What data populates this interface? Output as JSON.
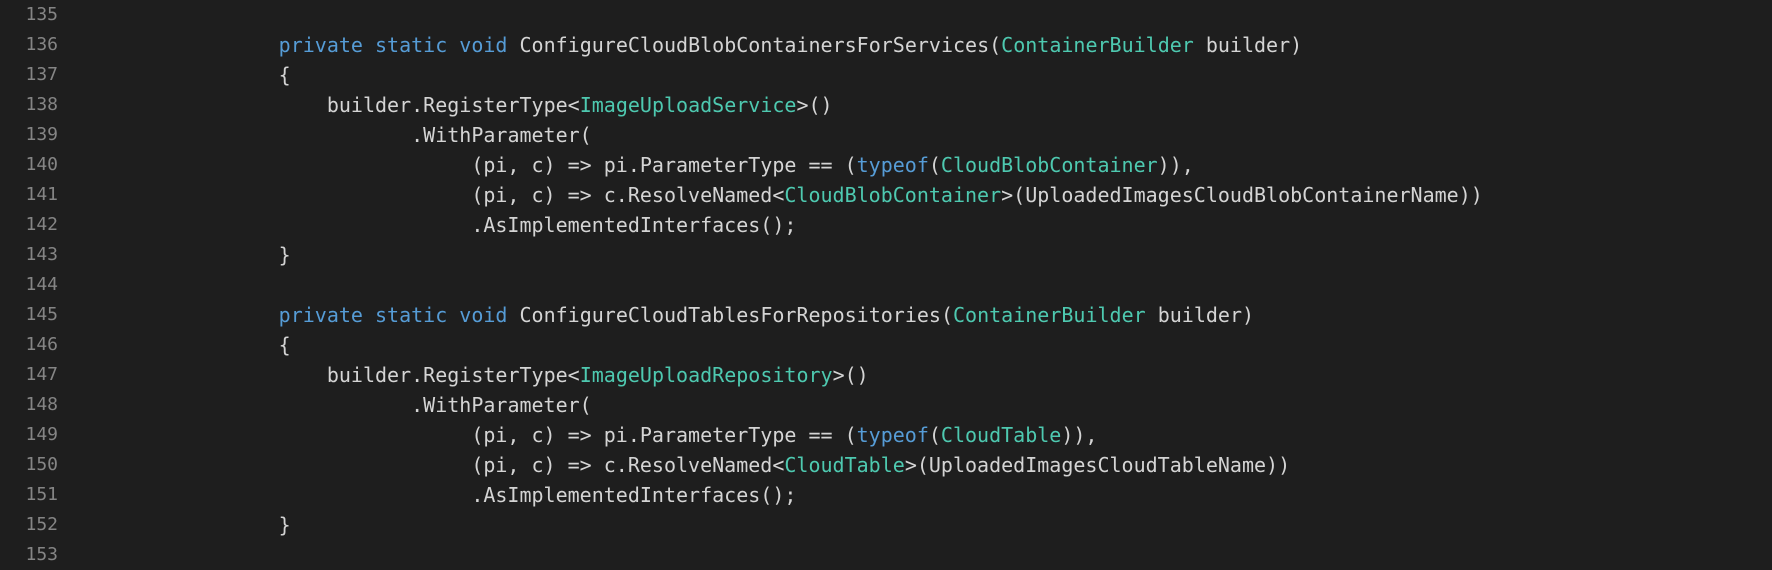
{
  "colors": {
    "background": "#1e1e1e",
    "gutter": "#858585",
    "text": "#d4d4d4",
    "keyword": "#569cd6",
    "type": "#4ec9b0"
  },
  "gutter": {
    "start": 135,
    "end": 153
  },
  "code": {
    "lines": [
      {
        "num": 135,
        "indent": 0,
        "tokens": []
      },
      {
        "num": 136,
        "indent": 16,
        "tokens": [
          {
            "t": "private",
            "c": "kw"
          },
          {
            "t": " "
          },
          {
            "t": "static",
            "c": "kw"
          },
          {
            "t": " "
          },
          {
            "t": "void",
            "c": "kw"
          },
          {
            "t": " ConfigureCloudBlobContainersForServices("
          },
          {
            "t": "ContainerBuilder",
            "c": "type"
          },
          {
            "t": " builder)"
          }
        ]
      },
      {
        "num": 137,
        "indent": 16,
        "tokens": [
          {
            "t": "{"
          }
        ]
      },
      {
        "num": 138,
        "indent": 20,
        "tokens": [
          {
            "t": "builder.RegisterType<"
          },
          {
            "t": "ImageUploadService",
            "c": "type"
          },
          {
            "t": ">()"
          }
        ]
      },
      {
        "num": 139,
        "indent": 27,
        "tokens": [
          {
            "t": ".WithParameter("
          }
        ]
      },
      {
        "num": 140,
        "indent": 32,
        "tokens": [
          {
            "t": "(pi, c) => pi.ParameterType == ("
          },
          {
            "t": "typeof",
            "c": "kw"
          },
          {
            "t": "("
          },
          {
            "t": "CloudBlobContainer",
            "c": "type"
          },
          {
            "t": ")),"
          }
        ]
      },
      {
        "num": 141,
        "indent": 32,
        "tokens": [
          {
            "t": "(pi, c) => c.ResolveNamed<"
          },
          {
            "t": "CloudBlobContainer",
            "c": "type"
          },
          {
            "t": ">(UploadedImagesCloudBlobContainerName))"
          }
        ]
      },
      {
        "num": 142,
        "indent": 32,
        "tokens": [
          {
            "t": ".AsImplementedInterfaces();"
          }
        ]
      },
      {
        "num": 143,
        "indent": 16,
        "tokens": [
          {
            "t": "}"
          }
        ]
      },
      {
        "num": 144,
        "indent": 0,
        "tokens": []
      },
      {
        "num": 145,
        "indent": 16,
        "tokens": [
          {
            "t": "private",
            "c": "kw"
          },
          {
            "t": " "
          },
          {
            "t": "static",
            "c": "kw"
          },
          {
            "t": " "
          },
          {
            "t": "void",
            "c": "kw"
          },
          {
            "t": " ConfigureCloudTablesForRepositories("
          },
          {
            "t": "ContainerBuilder",
            "c": "type"
          },
          {
            "t": " builder)"
          }
        ]
      },
      {
        "num": 146,
        "indent": 16,
        "tokens": [
          {
            "t": "{"
          }
        ]
      },
      {
        "num": 147,
        "indent": 20,
        "tokens": [
          {
            "t": "builder.RegisterType<"
          },
          {
            "t": "ImageUploadRepository",
            "c": "type"
          },
          {
            "t": ">()"
          }
        ]
      },
      {
        "num": 148,
        "indent": 27,
        "tokens": [
          {
            "t": ".WithParameter("
          }
        ]
      },
      {
        "num": 149,
        "indent": 32,
        "tokens": [
          {
            "t": "(pi, c) => pi.ParameterType == ("
          },
          {
            "t": "typeof",
            "c": "kw"
          },
          {
            "t": "("
          },
          {
            "t": "CloudTable",
            "c": "type"
          },
          {
            "t": ")),"
          }
        ]
      },
      {
        "num": 150,
        "indent": 32,
        "tokens": [
          {
            "t": "(pi, c) => c.ResolveNamed<"
          },
          {
            "t": "CloudTable",
            "c": "type"
          },
          {
            "t": ">(UploadedImagesCloudTableName))"
          }
        ]
      },
      {
        "num": 151,
        "indent": 32,
        "tokens": [
          {
            "t": ".AsImplementedInterfaces();"
          }
        ]
      },
      {
        "num": 152,
        "indent": 16,
        "tokens": [
          {
            "t": "}"
          }
        ]
      },
      {
        "num": 153,
        "indent": 0,
        "tokens": []
      }
    ]
  }
}
